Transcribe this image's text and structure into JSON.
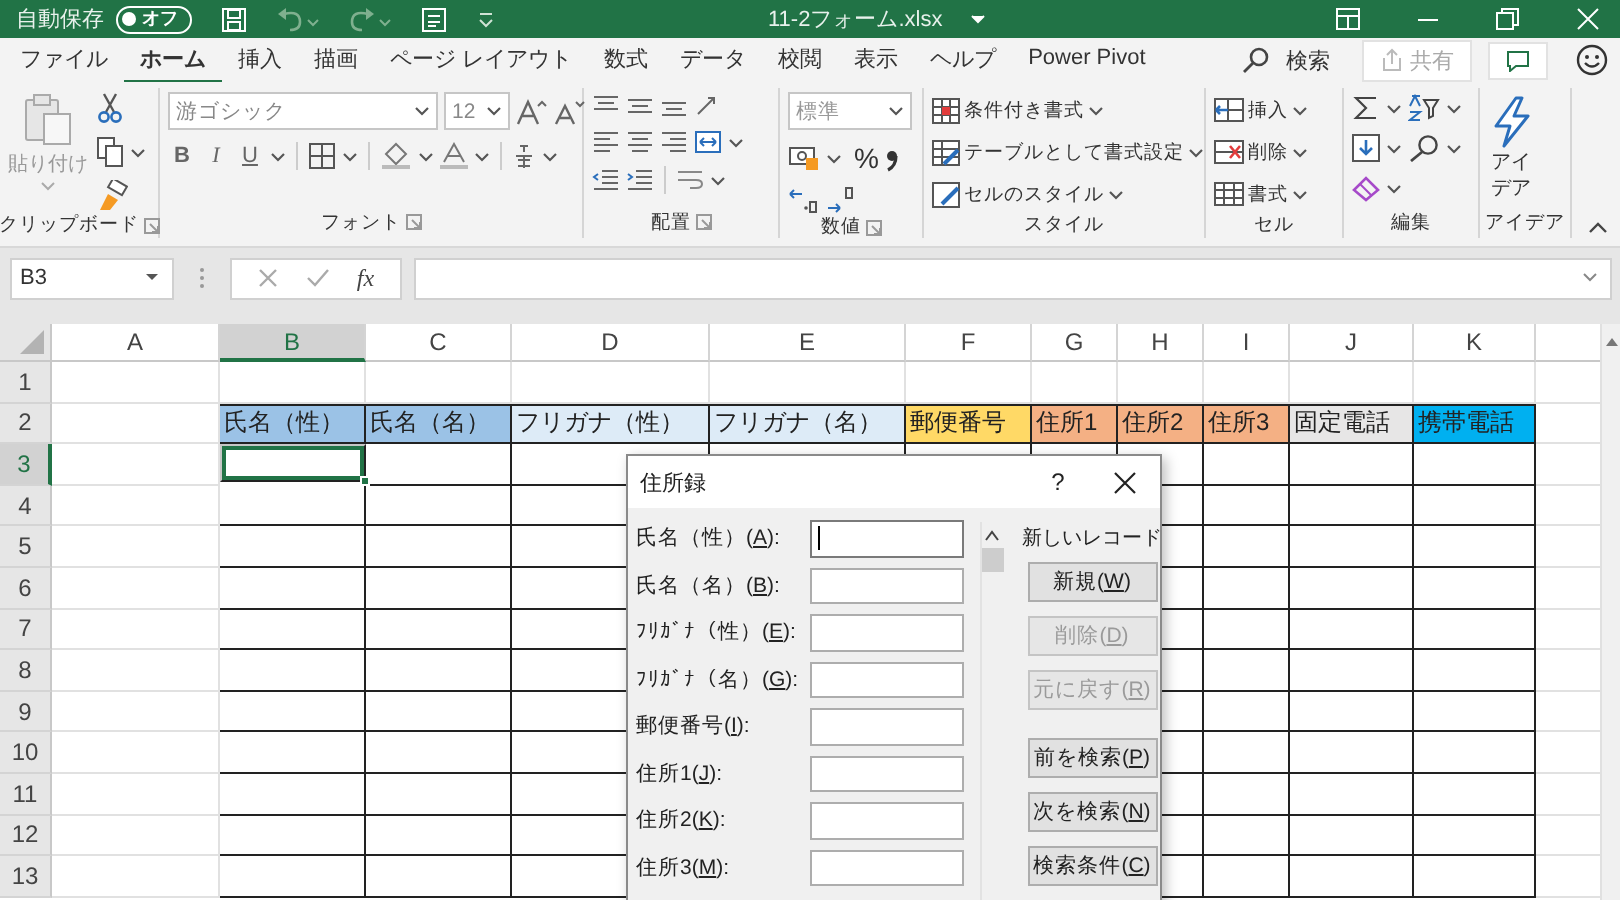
{
  "title_bar": {
    "autosave_label": "自動保存",
    "autosave_toggle": {
      "label": "オフ",
      "on": false
    },
    "filename": "11-2フォーム.xlsx"
  },
  "menu_tabs": [
    {
      "label": "ファイル",
      "selected": false
    },
    {
      "label": "ホーム",
      "selected": true
    },
    {
      "label": "挿入",
      "selected": false
    },
    {
      "label": "描画",
      "selected": false
    },
    {
      "label": "ページ レイアウト",
      "selected": false
    },
    {
      "label": "数式",
      "selected": false
    },
    {
      "label": "データ",
      "selected": false
    },
    {
      "label": "校閲",
      "selected": false
    },
    {
      "label": "表示",
      "selected": false
    },
    {
      "label": "ヘルプ",
      "selected": false
    },
    {
      "label": "Power Pivot",
      "selected": false
    }
  ],
  "search": {
    "label": "検索"
  },
  "share_button": {
    "label": "共有",
    "disabled": true
  },
  "ribbon": {
    "clipboard": {
      "label": "クリップボード",
      "paste": "貼り付け"
    },
    "font": {
      "label": "フォント",
      "font_name": "游ゴシック",
      "font_size": "12",
      "buttons": [
        "B",
        "I",
        "U"
      ]
    },
    "alignment": {
      "label": "配置"
    },
    "number": {
      "label": "数値",
      "format": "標準",
      "percent": "%"
    },
    "styles": {
      "label": "スタイル",
      "items": [
        "条件付き書式",
        "テーブルとして書式設定",
        "セルのスタイル"
      ]
    },
    "cells": {
      "label": "セル",
      "items": [
        "挿入",
        "削除",
        "書式"
      ]
    },
    "editing": {
      "label": "編集"
    },
    "ideas": {
      "label": "アイデア",
      "button": "アイデア"
    }
  },
  "formula_bar": {
    "name_box": "B3",
    "function_label": "fx"
  },
  "sheet": {
    "columns": [
      {
        "label": "A",
        "selected": false
      },
      {
        "label": "B",
        "selected": true
      },
      {
        "label": "C",
        "selected": false
      },
      {
        "label": "D",
        "selected": false
      },
      {
        "label": "E",
        "selected": false
      },
      {
        "label": "F",
        "selected": false
      },
      {
        "label": "G",
        "selected": false
      },
      {
        "label": "H",
        "selected": false
      },
      {
        "label": "I",
        "selected": false
      },
      {
        "label": "J",
        "selected": false
      },
      {
        "label": "K",
        "selected": false
      }
    ],
    "rows": [
      {
        "label": "1",
        "selected": false
      },
      {
        "label": "2",
        "selected": false
      },
      {
        "label": "3",
        "selected": true
      },
      {
        "label": "4",
        "selected": false
      },
      {
        "label": "5",
        "selected": false
      },
      {
        "label": "6",
        "selected": false
      },
      {
        "label": "7",
        "selected": false
      },
      {
        "label": "8",
        "selected": false
      },
      {
        "label": "9",
        "selected": false
      },
      {
        "label": "10",
        "selected": false
      },
      {
        "label": "11",
        "selected": false
      },
      {
        "label": "12",
        "selected": false
      },
      {
        "label": "13",
        "selected": false
      }
    ],
    "table_header": [
      {
        "text": "氏名（性）",
        "color": "#9bc2e6"
      },
      {
        "text": "氏名（名）",
        "color": "#9bc2e6"
      },
      {
        "text": "フリガナ（性）",
        "color": "#ddebf7"
      },
      {
        "text": "フリガナ（名）",
        "color": "#ddebf7"
      },
      {
        "text": "郵便番号",
        "color": "#ffd966"
      },
      {
        "text": "住所1",
        "color": "#f4b084"
      },
      {
        "text": "住所2",
        "color": "#f4b084"
      },
      {
        "text": "住所3",
        "color": "#f4b084"
      },
      {
        "text": "固定電話",
        "color": "#e7e6e6"
      },
      {
        "text": "携帯電話",
        "color": "#00b0f0"
      }
    ]
  },
  "dialog": {
    "title": "住所録",
    "help": "?",
    "record_status": "新しいレコード",
    "fields": [
      {
        "label_before": "氏名（性）(",
        "access_key": "A",
        "label_after": "):",
        "focused": true
      },
      {
        "label_before": "氏名（名）(",
        "access_key": "B",
        "label_after": "):",
        "focused": false
      },
      {
        "label_before": "ﾌﾘｶﾞﾅ（性）(",
        "access_key": "E",
        "label_after": "):",
        "focused": false
      },
      {
        "label_before": "ﾌﾘｶﾞﾅ（名）(",
        "access_key": "G",
        "label_after": "):",
        "focused": false
      },
      {
        "label_before": "郵便番号(",
        "access_key": "I",
        "label_after": "):",
        "focused": false
      },
      {
        "label_before": "住所1(",
        "access_key": "J",
        "label_after": "):",
        "focused": false
      },
      {
        "label_before": "住所2(",
        "access_key": "K",
        "label_after": "):",
        "focused": false
      },
      {
        "label_before": "住所3(",
        "access_key": "M",
        "label_after": "):",
        "focused": false
      }
    ],
    "buttons": [
      {
        "label_before": "新規(",
        "access_key": "W",
        "label_after": ")",
        "disabled": false
      },
      {
        "label_before": "削除(",
        "access_key": "D",
        "label_after": ")",
        "disabled": true
      },
      {
        "label_before": "元に戻す(",
        "access_key": "R",
        "label_after": ")",
        "disabled": true
      },
      {
        "label_before": "前を検索(",
        "access_key": "P",
        "label_after": ")",
        "disabled": false
      },
      {
        "label_before": "次を検索(",
        "access_key": "N",
        "label_after": ")",
        "disabled": false
      },
      {
        "label_before": "検索条件(",
        "access_key": "C",
        "label_after": ")",
        "disabled": false
      }
    ]
  }
}
